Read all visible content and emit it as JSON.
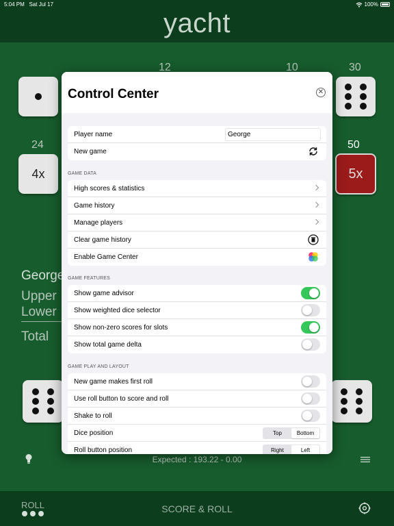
{
  "status_bar": {
    "time": "5:04 PM",
    "date": "Sat Jul 17",
    "battery": "100%"
  },
  "app": {
    "title": "yacht"
  },
  "board": {
    "score_numbers": {
      "top_a": "12",
      "top_b": "10",
      "top_right": "30",
      "left": "24",
      "right": "50"
    },
    "dice_labels": {
      "left_multiplier": "4x",
      "right_multiplier": "5x"
    },
    "scoreboard": {
      "player": "George",
      "upper": "Upper",
      "lower": "Lower",
      "total": "Total"
    },
    "expected": "Expected : 193.22 - 0.00"
  },
  "bottom_bar": {
    "roll_label": "ROLL",
    "score_roll_label": "SCORE & ROLL"
  },
  "control_center": {
    "title": "Control Center",
    "close_glyph": "✕",
    "player_name_label": "Player name",
    "player_name_value": "George",
    "new_game_label": "New game",
    "game_data": {
      "header": "GAME DATA",
      "high_scores": "High scores & statistics",
      "history": "Game history",
      "manage_players": "Manage players",
      "clear_history": "Clear game history",
      "game_center": "Enable Game Center"
    },
    "game_features": {
      "header": "GAME FEATURES",
      "advisor": "Show game advisor",
      "advisor_on": true,
      "weighted_dice": "Show weighted dice selector",
      "weighted_dice_on": false,
      "nonzero_scores": "Show non-zero scores for slots",
      "nonzero_scores_on": true,
      "total_delta": "Show total game delta",
      "total_delta_on": false
    },
    "game_play": {
      "header": "GAME PLAY AND LAYOUT",
      "first_roll": "New game makes first roll",
      "first_roll_on": false,
      "roll_button_score": "Use roll button to score and roll",
      "roll_button_score_on": false,
      "shake_to_roll": "Shake to roll",
      "shake_to_roll_on": false,
      "dice_position": "Dice position",
      "dice_position_options": [
        "Top",
        "Bottom"
      ],
      "dice_position_selected": "Bottom",
      "roll_button_position": "Roll button position",
      "roll_button_position_options": [
        "Right",
        "Left"
      ],
      "roll_button_position_selected": "Left"
    }
  },
  "colors": {
    "felt": "#175c2d",
    "felt_dark": "#0c3d1d",
    "toggle_on": "#34c759",
    "red_die": "#9b1b1b"
  },
  "icons": [
    "wifi-icon",
    "battery-icon",
    "refresh-icon",
    "chevron-right-icon",
    "trash-icon",
    "game-center-icon",
    "bulb-icon",
    "menu-icon",
    "settings-icon",
    "close-icon"
  ]
}
